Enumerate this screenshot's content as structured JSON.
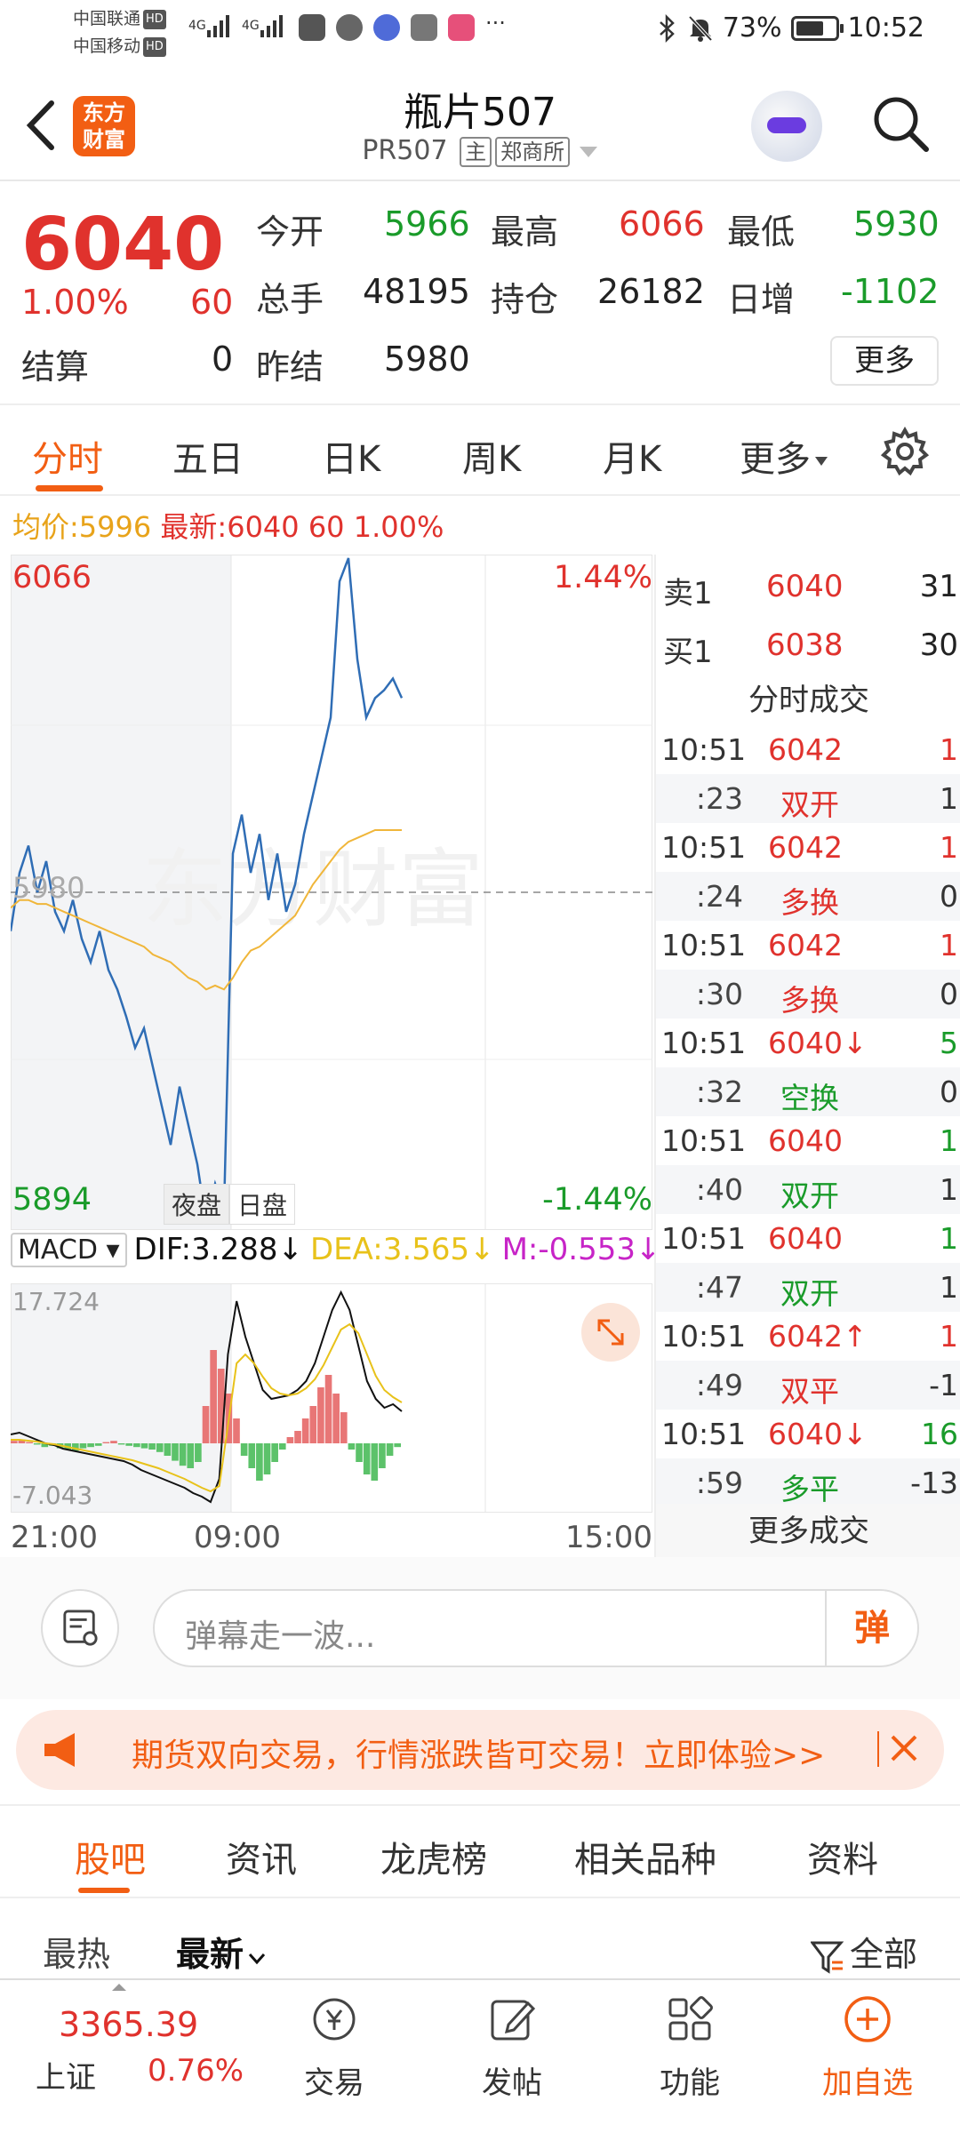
{
  "status": {
    "carrier1": "中国联通",
    "carrier2": "中国移动",
    "hd": "HD",
    "signal_label": "4G",
    "more": "···",
    "battery": "73%",
    "battery_level": 0.73,
    "time": "10:52"
  },
  "header": {
    "logo_text_1": "东方",
    "logo_text_2": "财富",
    "title": "瓶片507",
    "code": "PR507",
    "tag_main": "主",
    "tag_exchange": "郑商所"
  },
  "quote": {
    "price": "6040",
    "pct": "1.00%",
    "change": "60",
    "labels": {
      "open": "今开",
      "high": "最高",
      "low": "最低",
      "volume": "总手",
      "oi": "持仓",
      "daily_inc": "日增",
      "settle": "结算",
      "prev_settle": "昨结"
    },
    "open": "5966",
    "high": "6066",
    "low": "5930",
    "volume": "48195",
    "oi": "26182",
    "daily_inc": "-1102",
    "settle": "0",
    "prev_settle": "5980",
    "more_label": "更多"
  },
  "tabs": [
    "分时",
    "五日",
    "日K",
    "周K",
    "月K",
    "更多"
  ],
  "avg": {
    "avg_label": "均价:",
    "avg_value": "5996",
    "latest_label": "最新:",
    "latest_value": "6040",
    "latest_change": "60",
    "latest_pct": "1.00%"
  },
  "chart": {
    "top_price": "6066",
    "bottom_price": "5894",
    "top_pct": "1.44%",
    "bottom_pct": "-1.44%",
    "ref_price": "5980",
    "night_session": "夜盘",
    "day_session": "日盘",
    "time_start": "21:00",
    "time_mid": "09:00",
    "time_end": "15:00"
  },
  "chart_data": {
    "type": "line",
    "ylim": [
      5894,
      6066
    ],
    "reference": 5980,
    "series": [
      {
        "name": "最新",
        "color": "#2f6db5",
        "values": [
          5970,
          5985,
          5992,
          5980,
          5988,
          5975,
          5970,
          5978,
          5968,
          5962,
          5970,
          5960,
          5955,
          5948,
          5940,
          5945,
          5935,
          5925,
          5915,
          5930,
          5920,
          5910,
          5895,
          5905,
          5898,
          5990,
          6000,
          5985,
          5995,
          5978,
          5990,
          5975,
          5982,
          5995,
          6005,
          6015,
          6025,
          6060,
          6066,
          6040,
          6025,
          6030,
          6032,
          6035,
          6030
        ],
        "x_points": 45
      },
      {
        "name": "均价",
        "color": "#f0b63a",
        "values": [
          5976,
          5978,
          5978,
          5977,
          5977,
          5976,
          5975,
          5974,
          5973,
          5972,
          5971,
          5970,
          5969,
          5968,
          5967,
          5966,
          5964,
          5963,
          5962,
          5960,
          5958,
          5957,
          5955,
          5956,
          5955,
          5958,
          5962,
          5965,
          5966,
          5968,
          5970,
          5972,
          5974,
          5978,
          5982,
          5985,
          5988,
          5991,
          5993,
          5994,
          5995,
          5996,
          5996,
          5996,
          5996
        ]
      }
    ]
  },
  "macd": {
    "selector": "MACD",
    "dif_label": "DIF:3.288",
    "dea_label": "DEA:3.565",
    "m_label": "M:-0.553",
    "top_value": "17.724",
    "bottom_value": "-7.043",
    "dif_color": "#111111",
    "dea_color": "#e8c21a",
    "m_color": "#c724c7"
  },
  "book": {
    "ask_label": "卖1",
    "ask_price": "6040",
    "ask_vol": "31",
    "bid_label": "买1",
    "bid_price": "6038",
    "bid_vol": "30",
    "trades_title": "分时成交",
    "trades": [
      {
        "t": "10:51",
        "p": "6042",
        "pc": "red",
        "v": "1",
        "vc": "red"
      },
      {
        "t": ":23",
        "p": "双开",
        "pc": "red",
        "v": "1",
        "vc": "dark"
      },
      {
        "t": "10:51",
        "p": "6042",
        "pc": "red",
        "v": "1",
        "vc": "red"
      },
      {
        "t": ":24",
        "p": "多换",
        "pc": "red",
        "v": "0",
        "vc": "dark"
      },
      {
        "t": "10:51",
        "p": "6042",
        "pc": "red",
        "v": "1",
        "vc": "red"
      },
      {
        "t": ":30",
        "p": "多换",
        "pc": "red",
        "v": "0",
        "vc": "dark"
      },
      {
        "t": "10:51",
        "p": "6040↓",
        "pc": "red",
        "v": "5",
        "vc": "green"
      },
      {
        "t": ":32",
        "p": "空换",
        "pc": "green",
        "v": "0",
        "vc": "dark"
      },
      {
        "t": "10:51",
        "p": "6040",
        "pc": "red",
        "v": "1",
        "vc": "green"
      },
      {
        "t": ":40",
        "p": "双开",
        "pc": "green",
        "v": "1",
        "vc": "dark"
      },
      {
        "t": "10:51",
        "p": "6040",
        "pc": "red",
        "v": "1",
        "vc": "green"
      },
      {
        "t": ":47",
        "p": "双开",
        "pc": "green",
        "v": "1",
        "vc": "dark"
      },
      {
        "t": "10:51",
        "p": "6042↑",
        "pc": "red",
        "v": "1",
        "vc": "red"
      },
      {
        "t": ":49",
        "p": "双平",
        "pc": "red",
        "v": "-1",
        "vc": "dark"
      },
      {
        "t": "10:51",
        "p": "6040↓",
        "pc": "red",
        "v": "16",
        "vc": "green"
      },
      {
        "t": ":59",
        "p": "多平",
        "pc": "green",
        "v": "-13",
        "vc": "dark"
      }
    ],
    "more_trades": "更多成交"
  },
  "danmu": {
    "placeholder": "弹幕走一波...",
    "send_label": "弹"
  },
  "ad": {
    "text": "期货双向交易，行情涨跌皆可交易！立即体验>>"
  },
  "subtabs": [
    "股吧",
    "资讯",
    "龙虎榜",
    "相关品种",
    "资料"
  ],
  "sort": {
    "hot": "最热",
    "latest": "最新",
    "all": "全部"
  },
  "bottom": {
    "index_value": "3365.39",
    "index_name": "上证",
    "index_change": "0.76%",
    "nav": [
      "交易",
      "发帖",
      "功能",
      "加自选"
    ]
  },
  "colors": {
    "accent": "#f25e13",
    "up": "#e0322d",
    "down": "#1a9b2a"
  }
}
